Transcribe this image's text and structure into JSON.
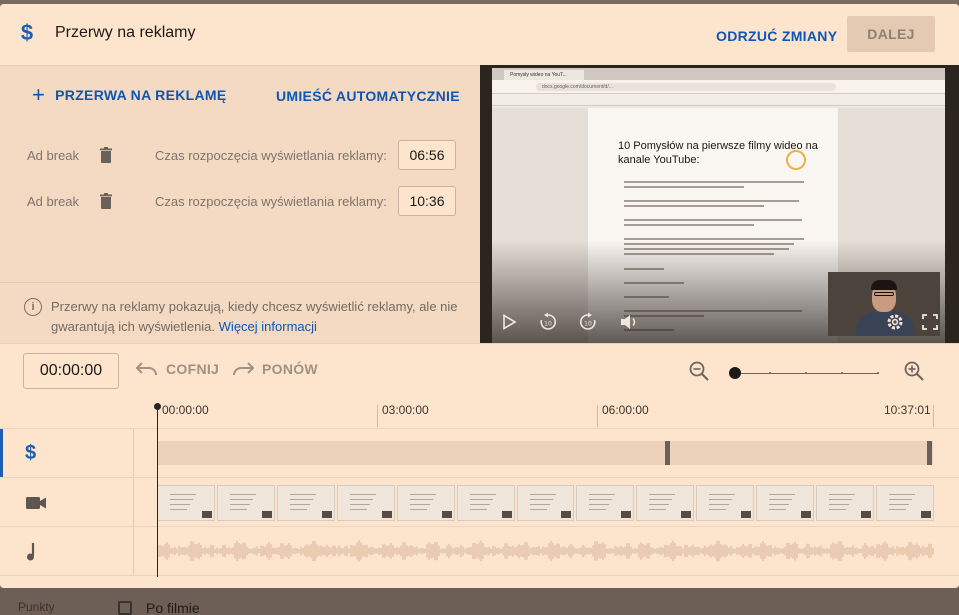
{
  "background": {
    "side_label": "Punkty",
    "after_video_label": "Po filmie"
  },
  "header": {
    "icon": "dollar-icon",
    "title": "Przerwy na reklamy",
    "discard_label": "ODRZUĆ ZMIANY",
    "next_label": "DALEJ"
  },
  "panel": {
    "add_break_label": "PRZERWA NA REKLAMĘ",
    "auto_place_label": "UMIEŚĆ AUTOMATYCZNIE",
    "ad_breaks": [
      {
        "label": "Ad break",
        "start_label": "Czas rozpoczęcia wyświetlania reklamy:",
        "time": "06:56"
      },
      {
        "label": "Ad break",
        "start_label": "Czas rozpoczęcia wyświetlania reklamy:",
        "time": "10:36"
      }
    ],
    "info_text": "Przerwy na reklamy pokazują, kiedy chcesz wyświetlić reklamy, ale nie gwarantują ich wyświetlenia.",
    "info_link": "Więcej informacji"
  },
  "preview": {
    "tab_title": "Pomysły wideo na YouT...",
    "url": "docs.google.com/document/d/...",
    "doc_title": "10 Pomysłów na pierwsze filmy wideo na kanale YouTube:"
  },
  "editor": {
    "timecode": "00:00:00",
    "undo_label": "COFNIJ",
    "redo_label": "PONÓW",
    "zoom_level": 0
  },
  "timeline": {
    "ruler_labels": [
      "00:00:00",
      "03:00:00",
      "06:00:00",
      "10:37:01"
    ],
    "duration": "10:37:01",
    "ad_break_times": [
      "06:56",
      "10:36"
    ],
    "tracks": [
      {
        "name": "ads",
        "icon": "dollar-icon"
      },
      {
        "name": "video",
        "icon": "video-camera-icon"
      },
      {
        "name": "audio",
        "icon": "music-note-icon"
      }
    ]
  },
  "colors": {
    "accent": "#0d56b3",
    "dialog_bg": "#fde4cc",
    "panel_bg": "#f4dac3",
    "disabled_button": "#e4cab2"
  }
}
